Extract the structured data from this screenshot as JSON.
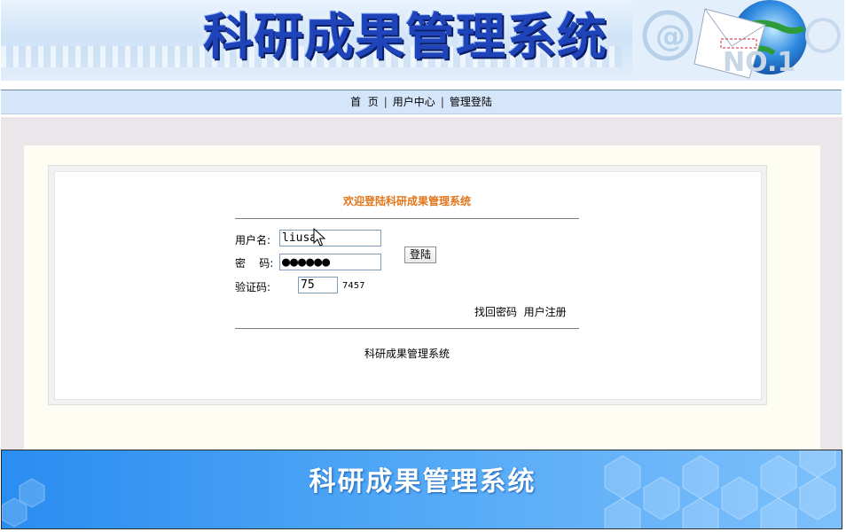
{
  "header": {
    "title": "科研成果管理系统"
  },
  "nav": {
    "items": [
      {
        "label": "首  页"
      },
      {
        "label": "用户中心"
      },
      {
        "label": "管理登陆"
      }
    ],
    "separator": "|"
  },
  "login": {
    "welcome": "欢迎登陆科研成果管理系统",
    "username_label": "用户名:",
    "username_value": "liusa",
    "password_label": "密    码:",
    "password_value": "●●●●●●",
    "captcha_label": "验证码:",
    "captcha_value": "75",
    "captcha_code": "7457",
    "login_button": "登陆",
    "forgot_link": "找回密码",
    "register_link": "用户注册",
    "system_name": "科研成果管理系统"
  },
  "footer": {
    "title": "科研成果管理系统"
  },
  "colors": {
    "welcome": "#e2761a",
    "nav_bg": "#d5e6fb",
    "footer_bg": "#4fa6f6"
  }
}
